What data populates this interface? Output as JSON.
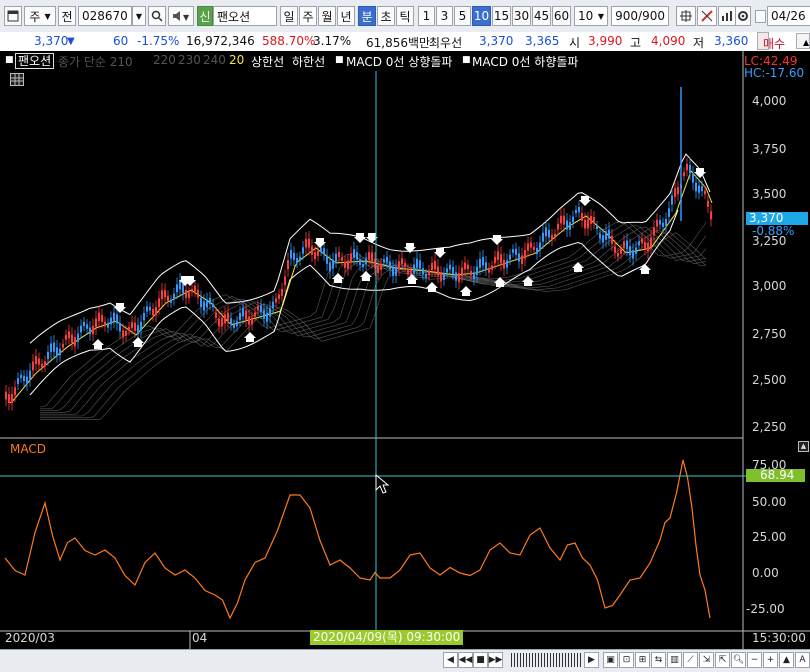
{
  "toolbar": {
    "type_label": "주",
    "prev_label": "전",
    "code_value": "028670",
    "new_badge": "신",
    "stock_name": "팬오션",
    "periods": [
      "일",
      "주",
      "월",
      "년",
      "분",
      "초",
      "틱"
    ],
    "selected_period": "분",
    "intervals": [
      "1",
      "3",
      "5",
      "10",
      "15",
      "30",
      "45",
      "60"
    ],
    "selected_interval": "10",
    "interval_select_value": "10",
    "count_value": "900",
    "count_total": "/900",
    "date_value": "04/26"
  },
  "quote": {
    "price": "3,370",
    "change": "60",
    "change_pct": "-1.75%",
    "volume": "16,972,346",
    "volume_ratio": "588.70%",
    "turnover": "3.17%",
    "amount": "61,856백만",
    "best_label": "최우선",
    "ask": "3,370",
    "bid": "3,365",
    "open_label": "시",
    "open": "3,990",
    "high_label": "고",
    "high": "4,090",
    "low_label": "저",
    "low": "3,360",
    "buy_button": "매수"
  },
  "legend": {
    "name": "팬오션",
    "items": [
      "종가 단순 210",
      "220",
      "230",
      "240",
      "20",
      "상한선",
      "하한선",
      "MACD 0선 상향돌파",
      "MACD 0선 하향돌파"
    ]
  },
  "price_axis": {
    "lc": "LC:42.49",
    "hc": "HC:-17.60",
    "ticks": [
      "4,000",
      "3,750",
      "3,500",
      "3,250",
      "3,000",
      "2,750",
      "2,500",
      "2,250"
    ],
    "current": "3,370",
    "current_pct": "-0.88%"
  },
  "macd_panel": {
    "title": "MACD",
    "ticks": [
      "75.00",
      "50.00",
      "25.00",
      "0.00",
      "-25.00"
    ],
    "current": "68.94"
  },
  "time_axis": {
    "start": "2020/03",
    "mid": "04",
    "cursor": "2020/04/09(목) 09:30:00",
    "end": "15:30:00"
  },
  "colors": {
    "background": "#000000",
    "macd_line": "#ff7a1a",
    "crosshair": "#36c9d8",
    "up_candle": "#ff3b3b",
    "down_candle": "#2f9bff",
    "highlight": "#9ac92a"
  }
}
